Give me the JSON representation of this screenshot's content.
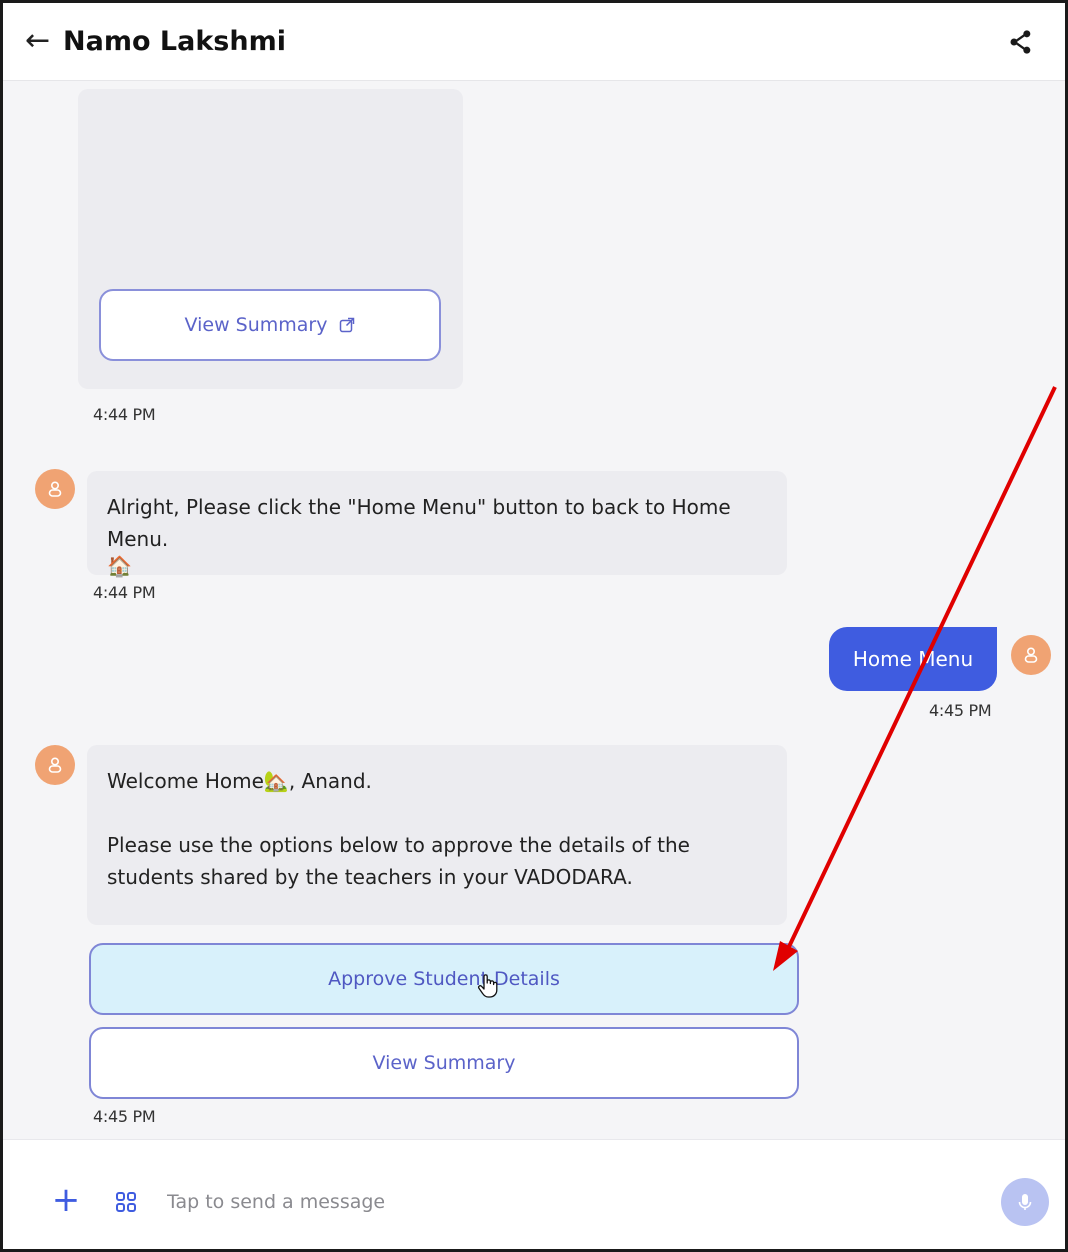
{
  "header": {
    "back_label": "←",
    "title": "Namo Lakshmi"
  },
  "messages": {
    "card_button": "View Summary",
    "time_1": "4:44 PM",
    "bot_msg_1": "Alright, Please click the \"Home Menu\" button to back to Home Menu.",
    "bot_msg_1_emoji": "🏠",
    "time_2": "4:44 PM",
    "user_msg": "Home Menu",
    "time_3": "4:45 PM",
    "bot_msg_2_line1": "Welcome Home",
    "bot_msg_2_emoji": "🏡",
    "bot_msg_2_line1_end": ", Anand.",
    "bot_msg_2_line2": "Please use the options below to approve the details of the students shared by the teachers in your VADODARA.",
    "option_approve": "Approve Student Details",
    "option_summary": "View Summary",
    "time_4": "4:45 PM"
  },
  "composer": {
    "plus_label": "+",
    "placeholder": "Tap to send a message"
  },
  "colors": {
    "accent": "#3f5ce0",
    "avatar": "#f0a373",
    "annotation_arrow": "#e00000"
  }
}
